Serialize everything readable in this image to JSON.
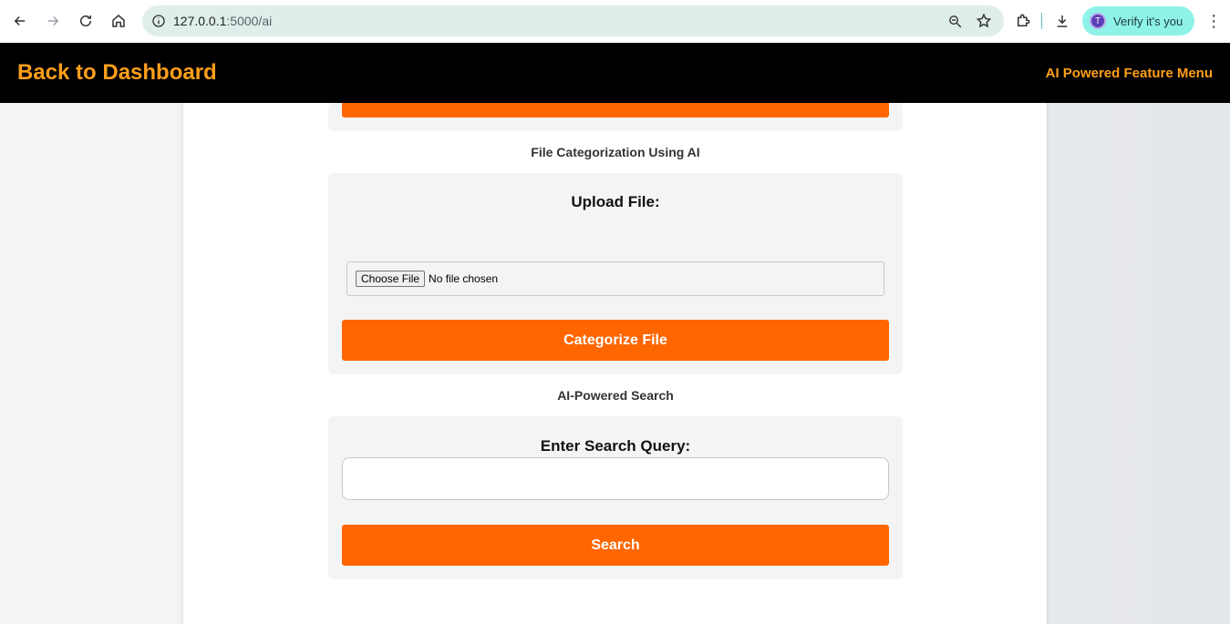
{
  "browser": {
    "url_host": "127.0.0.1",
    "url_path": ":5000/ai",
    "profile_label": "Verify it's you",
    "profile_initial": "T"
  },
  "header": {
    "back_link": "Back to Dashboard",
    "menu_link": "AI Powered Feature Menu"
  },
  "categorization": {
    "section_title": "File Categorization Using AI",
    "upload_label": "Upload File:",
    "choose_button": "Choose File",
    "file_status": "No file chosen",
    "submit_label": "Categorize File"
  },
  "search": {
    "section_title": "AI-Powered Search",
    "query_label": "Enter Search Query:",
    "query_value": "",
    "submit_label": "Search"
  }
}
